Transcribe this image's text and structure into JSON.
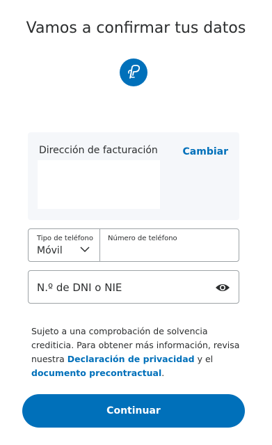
{
  "page": {
    "title": "Vamos a confirmar tus datos",
    "logo_icon": "paypal-logo-icon",
    "accent_color": "#0070ba"
  },
  "billing": {
    "label": "Dirección de facturación",
    "change_label": "Cambiar"
  },
  "phone": {
    "type_label": "Tipo de teléfono",
    "type_value": "Móvil",
    "number_label": "Número de teléfono",
    "number_value": ""
  },
  "dni": {
    "placeholder": "N.º de DNI o NIE",
    "toggle_icon": "eye-icon"
  },
  "disclaimer": {
    "text_before": "Sujeto a una comprobación de solvencia crediticia. Para obtener más información, revisa nuestra ",
    "privacy_link": "Declaración de privacidad",
    "text_middle": " y el ",
    "precontract_link": "documento precontractual",
    "text_after": "."
  },
  "actions": {
    "continue_label": "Continuar"
  }
}
